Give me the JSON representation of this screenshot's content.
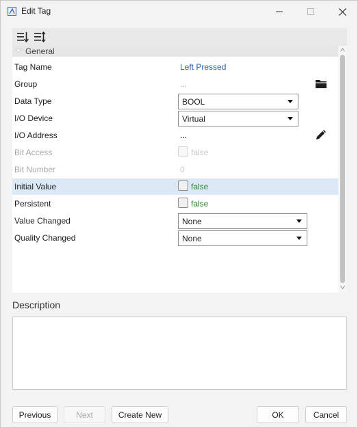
{
  "window": {
    "title": "Edit Tag",
    "icons": {
      "app": "app-logo-icon",
      "minimize": "minimize-icon",
      "maximize": "maximize-icon",
      "close": "close-icon"
    }
  },
  "toolbar": {
    "icons": [
      "sort-categorized-icon",
      "sort-alphabetical-icon"
    ]
  },
  "grid": {
    "category": "General",
    "rows": [
      {
        "label": "Tag Name",
        "value": "Left Pressed"
      },
      {
        "label": "Group",
        "value": "...",
        "icon": "folder-icon"
      },
      {
        "label": "Data Type",
        "value": "BOOL"
      },
      {
        "label": "I/O Device",
        "value": "Virtual"
      },
      {
        "label": "I/O Address",
        "value": "...",
        "icon": "pencil-icon"
      },
      {
        "label": "Bit Access",
        "value": "false",
        "disabled": true
      },
      {
        "label": "Bit Number",
        "value": "0",
        "disabled": true
      },
      {
        "label": "Initial Value",
        "value": "false",
        "highlighted": true
      },
      {
        "label": "Persistent",
        "value": "false"
      },
      {
        "label": "Value Changed",
        "value": "None"
      },
      {
        "label": "Quality Changed",
        "value": "None"
      }
    ]
  },
  "description": {
    "label": "Description",
    "value": ""
  },
  "buttons": {
    "previous": "Previous",
    "next": "Next",
    "create_new": "Create New",
    "ok": "OK",
    "cancel": "Cancel"
  }
}
